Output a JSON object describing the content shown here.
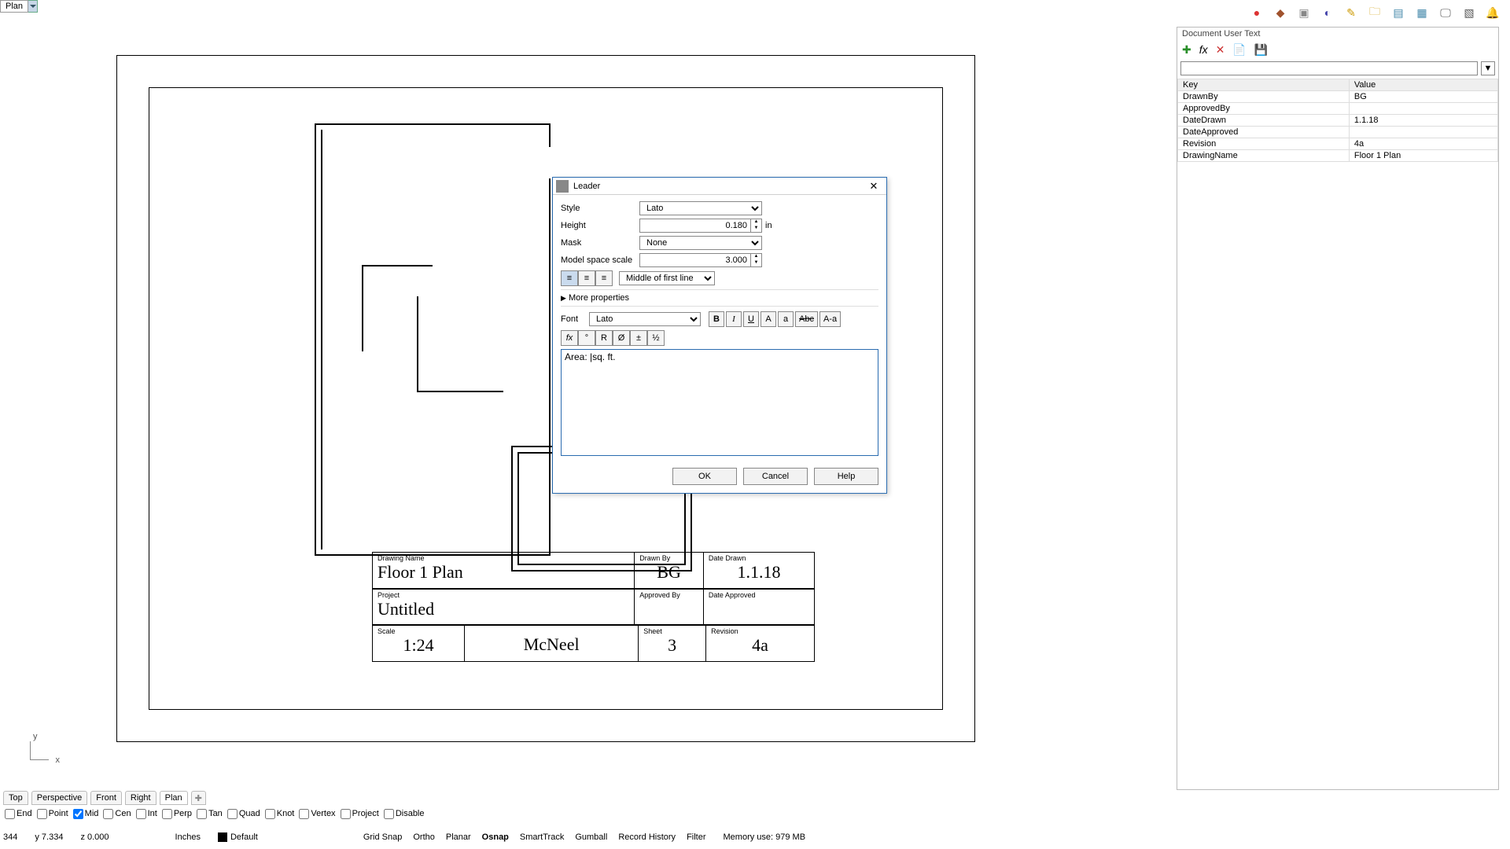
{
  "viewport": {
    "name": "Plan"
  },
  "axis": {
    "y": "y",
    "x": "x"
  },
  "view_tabs": [
    "Top",
    "Perspective",
    "Front",
    "Right",
    "Plan"
  ],
  "active_view_tab": "Plan",
  "osnaps": [
    {
      "label": "End",
      "checked": false
    },
    {
      "label": "Point",
      "checked": false
    },
    {
      "label": "Mid",
      "checked": true
    },
    {
      "label": "Cen",
      "checked": false
    },
    {
      "label": "Int",
      "checked": false
    },
    {
      "label": "Perp",
      "checked": false
    },
    {
      "label": "Tan",
      "checked": false
    },
    {
      "label": "Quad",
      "checked": false
    },
    {
      "label": "Knot",
      "checked": false
    },
    {
      "label": "Vertex",
      "checked": false
    },
    {
      "label": "Project",
      "checked": false
    },
    {
      "label": "Disable",
      "checked": false
    }
  ],
  "status": {
    "x": "344",
    "y": "y 7.334",
    "z": "z 0.000",
    "units": "Inches",
    "layer": "Default",
    "toggles": [
      "Grid Snap",
      "Ortho",
      "Planar",
      "Osnap",
      "SmartTrack",
      "Gumball",
      "Record History",
      "Filter"
    ],
    "active_toggle": "Osnap",
    "memory": "Memory use: 979 MB"
  },
  "panel": {
    "title": "Document User Text",
    "icons": {
      "add": "✚",
      "fx": "fx",
      "del": "✕",
      "import": "📄",
      "export": "💾"
    },
    "headers": {
      "key": "Key",
      "value": "Value"
    },
    "rows": [
      {
        "key": "DrawnBy",
        "value": "BG"
      },
      {
        "key": "ApprovedBy",
        "value": ""
      },
      {
        "key": "DateDrawn",
        "value": "1.1.18"
      },
      {
        "key": "DateApproved",
        "value": ""
      },
      {
        "key": "Revision",
        "value": "4a"
      },
      {
        "key": "DrawingName",
        "value": "Floor 1 Plan"
      }
    ]
  },
  "iconbar": [
    "●",
    "◆",
    "▣",
    "◐",
    "✎",
    "🗀",
    "▤",
    "▦",
    "🖵",
    "▧",
    "🔔"
  ],
  "dialog": {
    "title": "Leader",
    "style_label": "Style",
    "style_value": "Lato",
    "height_label": "Height",
    "height_value": "0.180",
    "height_unit": "in",
    "mask_label": "Mask",
    "mask_value": "None",
    "scale_label": "Model space scale",
    "scale_value": "3.000",
    "valign_value": "Middle of first line",
    "more": "More properties",
    "font_label": "Font",
    "font_value": "Lato",
    "fmt": {
      "b": "B",
      "i": "I",
      "u": "U",
      "upA": "A",
      "loA": "a",
      "abc": "Abc",
      "aa": "A-a"
    },
    "tool": {
      "fx": "fx",
      "deg": "°",
      "r": "R",
      "dia": "Ø",
      "pm": "±",
      "half": "½"
    },
    "text_value": "Area: |sq. ft.",
    "ok": "OK",
    "cancel": "Cancel",
    "help": "Help"
  },
  "titleblock": {
    "drawing_name_label": "Drawing Name",
    "drawing_name_value": "Floor 1 Plan",
    "drawn_by_label": "Drawn By",
    "drawn_by_value": "BG",
    "date_drawn_label": "Date Drawn",
    "date_drawn_value": "1.1.18",
    "project_label": "Project",
    "project_value": "Untitled",
    "approved_by_label": "Approved By",
    "approved_by_value": "",
    "date_approved_label": "Date Approved",
    "date_approved_value": "",
    "scale_label": "Scale",
    "scale_value": "1:24",
    "company_value": "McNeel",
    "sheet_label": "Sheet",
    "sheet_value": "3",
    "revision_label": "Revision",
    "revision_value": "4a"
  }
}
